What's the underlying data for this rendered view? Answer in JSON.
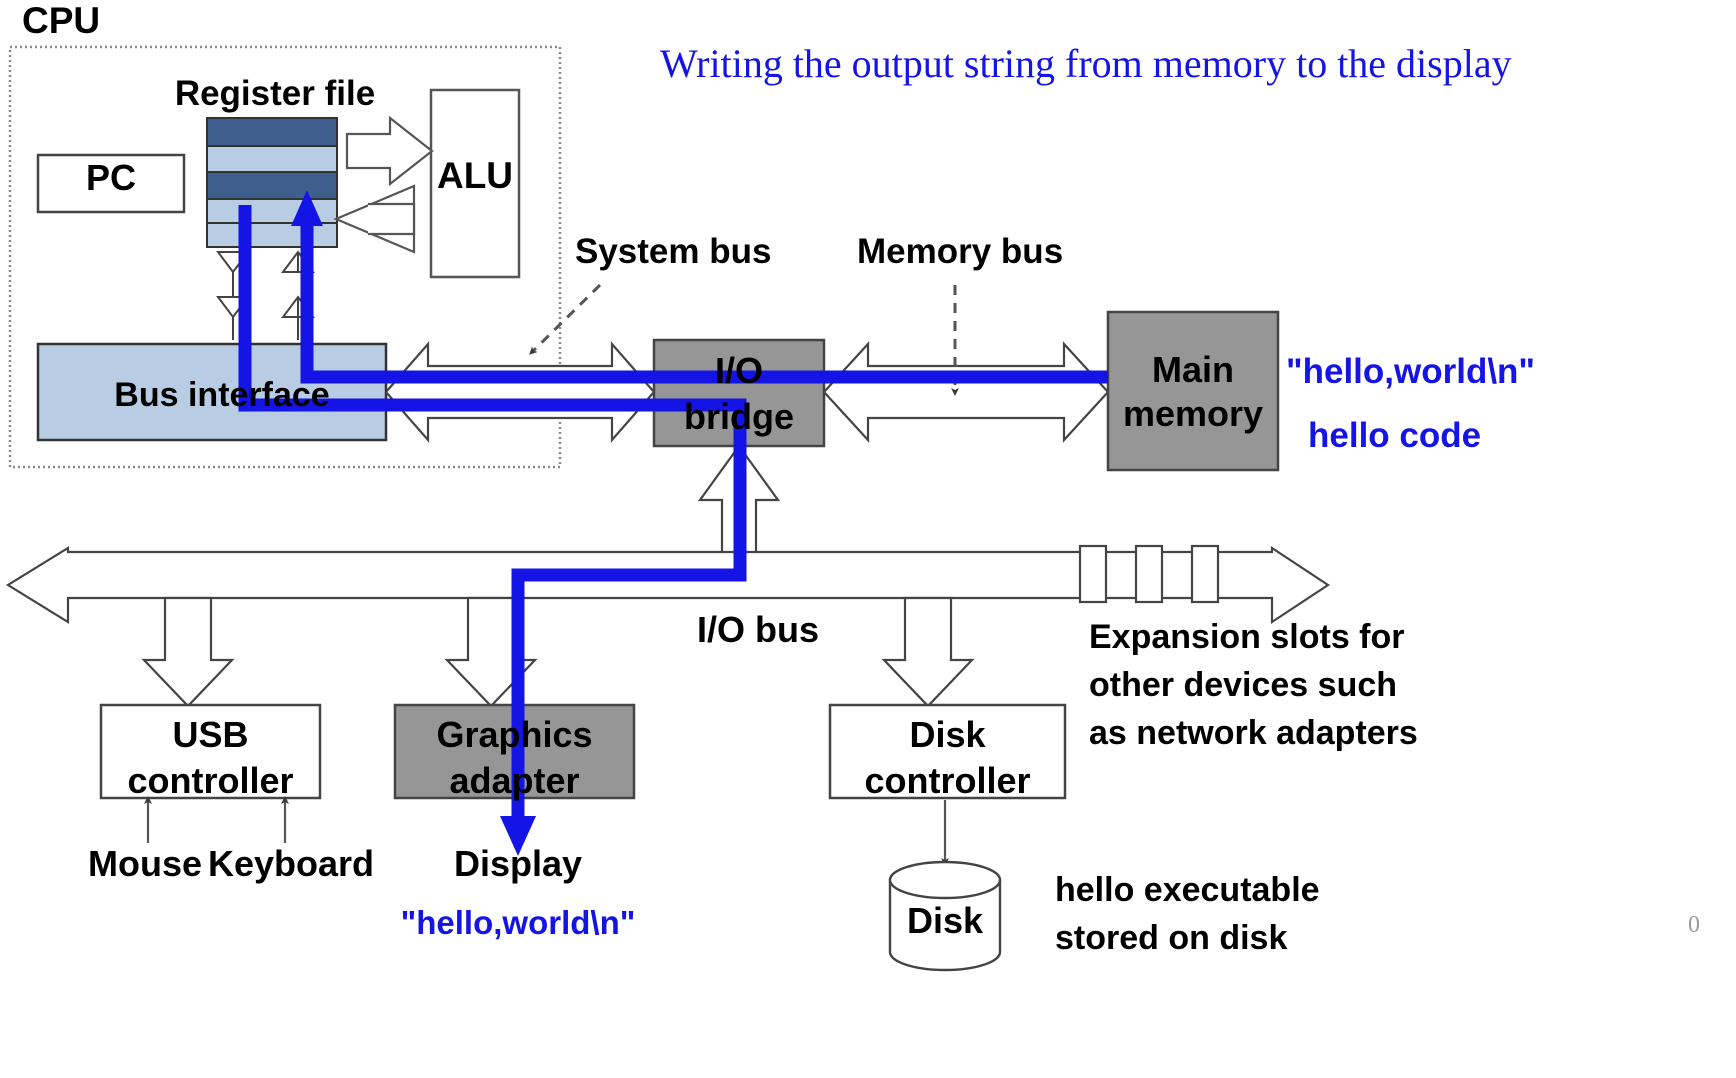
{
  "title": {
    "text": "Writing the output string from memory to the display",
    "color": "#1414E6"
  },
  "cpu": {
    "label": "CPU",
    "pc": "PC",
    "register_file": "Register file",
    "alu": "ALU",
    "bus_interface": "Bus interface"
  },
  "buses": {
    "system_bus": "System bus",
    "memory_bus": "Memory bus",
    "io_bus": "I/O bus"
  },
  "bridge": {
    "line1": "I/O",
    "line2": "bridge"
  },
  "memory": {
    "line1": "Main",
    "line2": "memory",
    "annotation_string": "\"hello,world\\n\"",
    "annotation_code": "hello code"
  },
  "devices": {
    "usb_controller_l1": "USB",
    "usb_controller_l2": "controller",
    "graphics_adapter_l1": "Graphics",
    "graphics_adapter_l2": "adapter",
    "disk_controller_l1": "Disk",
    "disk_controller_l2": "controller",
    "mouse": "Mouse",
    "keyboard": "Keyboard",
    "display": "Display",
    "disk": "Disk"
  },
  "annotations": {
    "display_output": "\"hello,world\\n\"",
    "expansion_l1": "Expansion slots for",
    "expansion_l2": "other devices such",
    "expansion_l3": "as network adapters",
    "disk_note_l1": "hello executable",
    "disk_note_l2": "stored on disk"
  },
  "page_number": "0",
  "colors": {
    "accent_blue": "#1414E6",
    "register_dark": "#3F5F8F",
    "register_light": "#B8CCE4",
    "bus_interface_fill": "#B8CCE4",
    "gray_fill": "#969696",
    "outline": "#3a3a3a"
  }
}
